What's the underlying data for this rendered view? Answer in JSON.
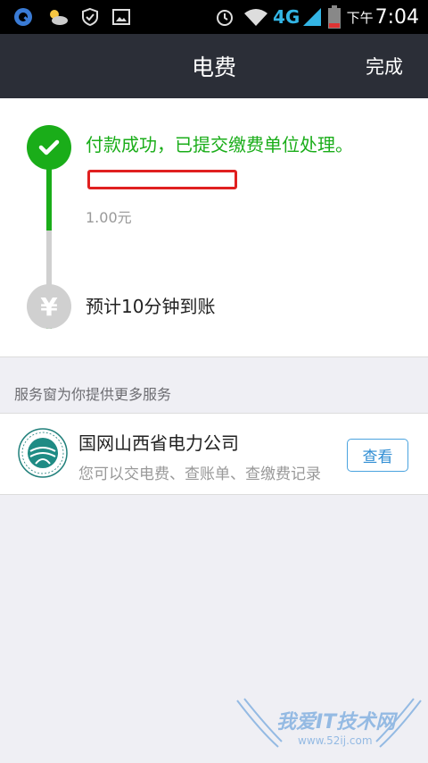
{
  "status_bar": {
    "network": "4G",
    "ampm": "下午",
    "time": "7:04"
  },
  "header": {
    "title": "电费",
    "done_label": "完成"
  },
  "payment": {
    "success_text": "付款成功，已提交缴费单位处理。",
    "amount": "1.00元",
    "eta_text": "预计10分钟到账"
  },
  "services": {
    "header": "服务窗为你提供更多服务",
    "items": [
      {
        "name": "国网山西省电力公司",
        "description": "您可以交电费、查账单、查缴费记录",
        "action_label": "查看"
      }
    ]
  },
  "watermark": {
    "text": "我爱IT技术网",
    "sub": "www.52ij.com"
  },
  "colors": {
    "success_green": "#1aad19",
    "title_bar_bg": "#2b2e37",
    "link_blue": "#2f8dd3"
  }
}
